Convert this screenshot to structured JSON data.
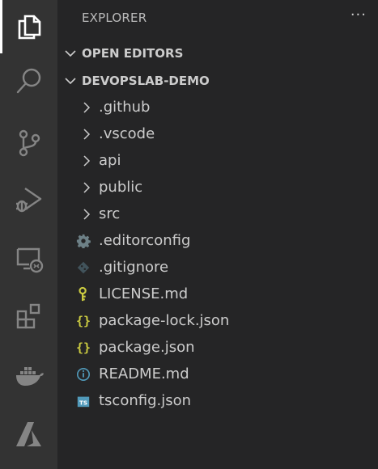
{
  "activity_bar": {
    "items": [
      {
        "name": "explorer-icon",
        "active": true
      },
      {
        "name": "search-icon"
      },
      {
        "name": "source-control-icon"
      },
      {
        "name": "run-debug-icon"
      },
      {
        "name": "remote-explorer-icon"
      },
      {
        "name": "extensions-icon"
      },
      {
        "name": "docker-icon"
      },
      {
        "name": "azure-icon"
      }
    ]
  },
  "sidebar": {
    "title": "EXPLORER",
    "more_label": "···",
    "open_editors_label": "OPEN EDITORS",
    "project_label": "DEVOPSLAB-DEMO",
    "folders": [
      {
        "label": ".github"
      },
      {
        "label": ".vscode"
      },
      {
        "label": "api"
      },
      {
        "label": "public"
      },
      {
        "label": "src"
      }
    ],
    "files": [
      {
        "label": ".editorconfig",
        "icon": "gear-icon"
      },
      {
        "label": ".gitignore",
        "icon": "git-diamond-icon"
      },
      {
        "label": "LICENSE.md",
        "icon": "license-key-icon"
      },
      {
        "label": "package-lock.json",
        "icon": "json-braces-icon"
      },
      {
        "label": "package.json",
        "icon": "json-braces-icon"
      },
      {
        "label": "README.md",
        "icon": "info-icon"
      },
      {
        "label": "tsconfig.json",
        "icon": "typescript-icon"
      }
    ]
  },
  "colors": {
    "activity_bg": "#333333",
    "sidebar_bg": "#252526",
    "json_yellow": "#cbcb41",
    "info_blue": "#519aba",
    "gear_grey": "#6d8086",
    "git_grey": "#41535b"
  }
}
